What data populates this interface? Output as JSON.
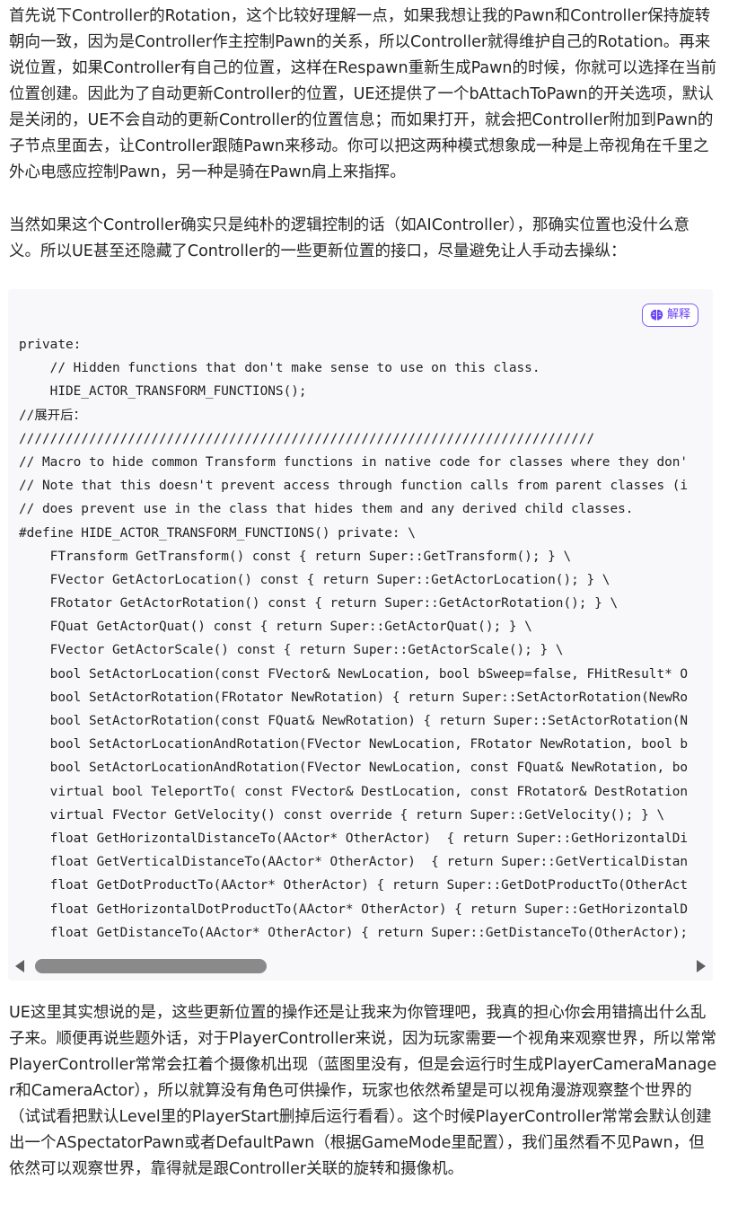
{
  "article": {
    "paragraph_1": "首先说下Controller的Rotation，这个比较好理解一点，如果我想让我的Pawn和Controller保持旋转朝向一致，因为是Controller作主控制Pawn的关系，所以Controller就得维护自己的Rotation。再来说位置，如果Controller有自己的位置，这样在Respawn重新生成Pawn的时候，你就可以选择在当前位置创建。因此为了自动更新Controller的位置，UE还提供了一个bAttachToPawn的开关选项，默认是关闭的，UE不会自动的更新Controller的位置信息；而如果打开，就会把Controller附加到Pawn的子节点里面去，让Controller跟随Pawn来移动。你可以把这两种模式想象成一种是上帝视角在千里之外心电感应控制Pawn，另一种是骑在Pawn肩上来指挥。",
    "paragraph_2": "当然如果这个Controller确实只是纯朴的逻辑控制的话（如AIController），那确实位置也没什么意义。所以UE甚至还隐藏了Controller的一些更新位置的接口，尽量避免让人手动去操纵：",
    "paragraph_3": "UE这里其实想说的是，这些更新位置的操作还是让我来为你管理吧，我真的担心你会用错搞出什么乱子来。顺便再说些题外话，对于PlayerController来说，因为玩家需要一个视角来观察世界，所以常常PlayerController常常会扛着个摄像机出现（蓝图里没有，但是会运行时生成PlayerCameraManager和CameraActor），所以就算没有角色可供操作，玩家也依然希望是可以视角漫游观察整个世界的（试试看把默认Level里的PlayerStart删掉后运行看看）。这个时候PlayerController常常会默认创建出一个ASpectatorPawn或者DefaultPawn（根据GameMode里配置），我们虽然看不见Pawn，但依然可以观察世界，靠得就是跟Controller关联的旋转和摄像机。"
  },
  "code_block": {
    "explain_label": "解释",
    "explain_icon": "brain-icon",
    "accent_color": "#6a45f5",
    "lines": [
      "private:",
      "    // Hidden functions that don't make sense to use on this class.",
      "    HIDE_ACTOR_TRANSFORM_FUNCTIONS();",
      "//展开后：",
      "//////////////////////////////////////////////////////////////////////////",
      "// Macro to hide common Transform functions in native code for classes where they don'",
      "// Note that this doesn't prevent access through function calls from parent classes (i",
      "// does prevent use in the class that hides them and any derived child classes.",
      "#define HIDE_ACTOR_TRANSFORM_FUNCTIONS() private: \\",
      "    FTransform GetTransform() const { return Super::GetTransform(); } \\",
      "    FVector GetActorLocation() const { return Super::GetActorLocation(); } \\",
      "    FRotator GetActorRotation() const { return Super::GetActorRotation(); } \\",
      "    FQuat GetActorQuat() const { return Super::GetActorQuat(); } \\",
      "    FVector GetActorScale() const { return Super::GetActorScale(); } \\",
      "    bool SetActorLocation(const FVector& NewLocation, bool bSweep=false, FHitResult* O",
      "    bool SetActorRotation(FRotator NewRotation) { return Super::SetActorRotation(NewRo",
      "    bool SetActorRotation(const FQuat& NewRotation) { return Super::SetActorRotation(N",
      "    bool SetActorLocationAndRotation(FVector NewLocation, FRotator NewRotation, bool b",
      "    bool SetActorLocationAndRotation(FVector NewLocation, const FQuat& NewRotation, bo",
      "    virtual bool TeleportTo( const FVector& DestLocation, const FRotator& DestRotation",
      "    virtual FVector GetVelocity() const override { return Super::GetVelocity(); } \\",
      "    float GetHorizontalDistanceTo(AActor* OtherActor)  { return Super::GetHorizontalDi",
      "    float GetVerticalDistanceTo(AActor* OtherActor)  { return Super::GetVerticalDistan",
      "    float GetDotProductTo(AActor* OtherActor) { return Super::GetDotProductTo(OtherAct",
      "    float GetHorizontalDotProductTo(AActor* OtherActor) { return Super::GetHorizontalD",
      "    float GetDistanceTo(AActor* OtherActor) { return Super::GetDistanceTo(OtherActor);"
    ]
  },
  "scrollbar": {
    "left_icon": "arrow-left-icon",
    "right_icon": "arrow-right-icon",
    "thumb_fraction": 0.35
  }
}
